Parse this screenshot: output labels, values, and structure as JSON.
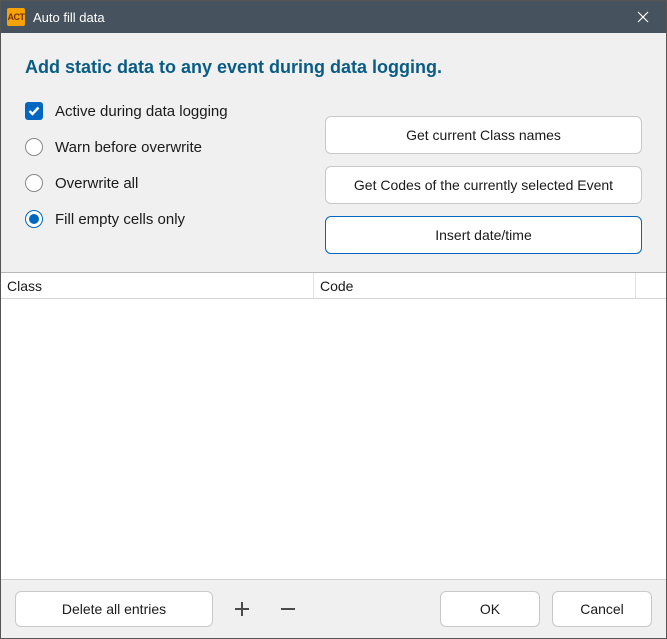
{
  "titlebar": {
    "app_icon_text": "ACT",
    "title": "Auto fill data"
  },
  "heading": "Add static data to any event during data logging.",
  "options": {
    "active_logging": {
      "label": "Active during data logging",
      "checked": true
    },
    "warn_overwrite": {
      "label": "Warn before overwrite",
      "selected": false
    },
    "overwrite_all": {
      "label": "Overwrite all",
      "selected": false
    },
    "fill_empty": {
      "label": "Fill empty cells only",
      "selected": true
    }
  },
  "buttons": {
    "get_class_names": "Get current Class names",
    "get_codes": "Get Codes of the currently selected Event",
    "insert_datetime": "Insert date/time"
  },
  "table": {
    "columns": {
      "class": "Class",
      "code": "Code"
    },
    "rows": []
  },
  "footer": {
    "delete_all": "Delete all entries",
    "ok": "OK",
    "cancel": "Cancel"
  }
}
